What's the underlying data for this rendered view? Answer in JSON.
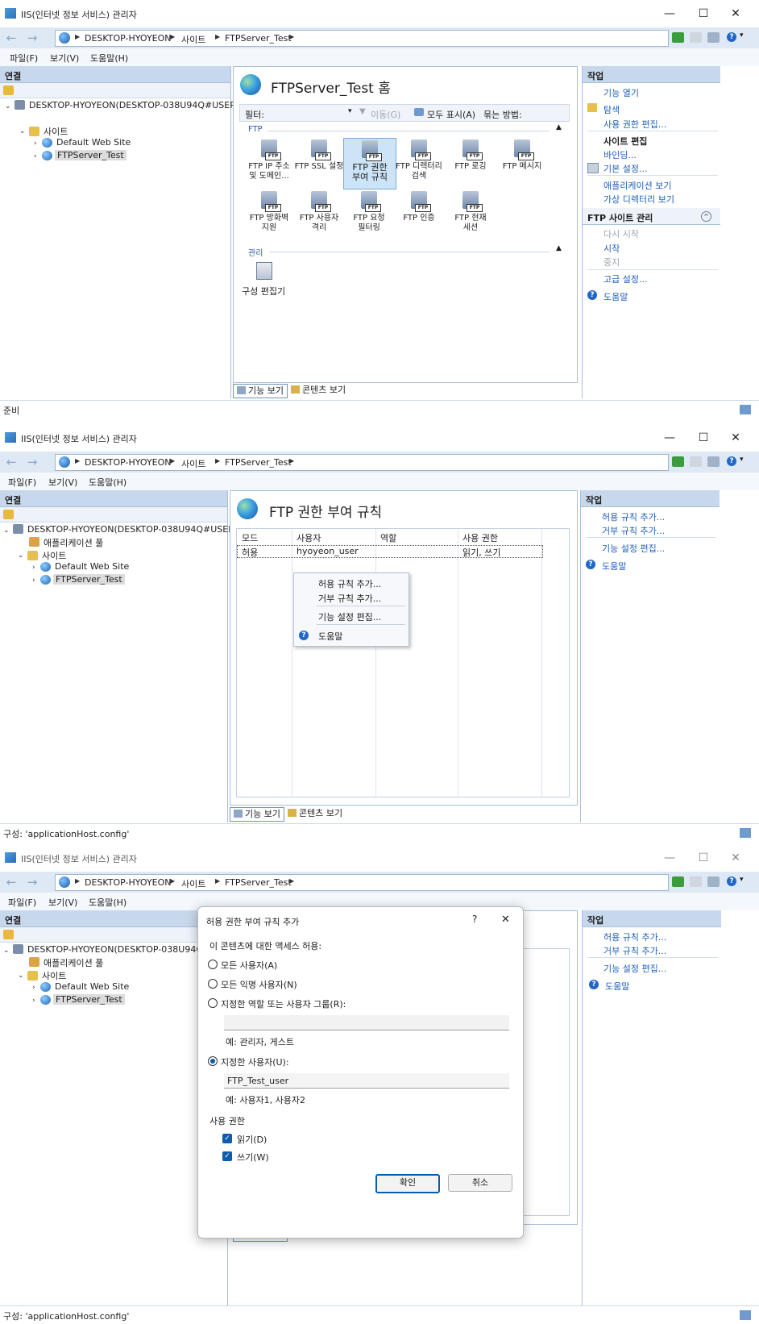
{
  "window": {
    "title": "IIS(인터넷 정보 서비스) 관리자",
    "controls": {
      "minimize": "—",
      "maximize": "☐",
      "close": "✕"
    }
  },
  "address": {
    "back": "←",
    "forward": "→",
    "crumbs": [
      "DESKTOP-HYOYEON",
      "사이트",
      "FTPServer_Test"
    ],
    "help_drop": "▾"
  },
  "menu": {
    "file": "파일(F)",
    "view": "보기(V)",
    "help": "도움말(H)"
  },
  "connections": {
    "title": "연결",
    "server": "DESKTOP-HYOYEON(DESKTOP-038U94Q#USER)",
    "server_short": "DESKTOP-HYOYEON(DESKTOP-038U94Q#U",
    "app_pools": "애플리케이션 풀",
    "sites": "사이트",
    "default_site": "Default Web Site",
    "ftp_site": "FTPServer_Test"
  },
  "panel1": {
    "title": "FTPServer_Test 홈",
    "filter_label": "필터:",
    "go": "이동(G)",
    "show_all": "모두 표시(A)",
    "group_by": "묶는 방법:",
    "group_ftp": "FTP",
    "group_mgmt": "관리",
    "tiles": [
      {
        "line1": "FTP IP 주소",
        "line2": "및 도메인..."
      },
      {
        "line1": "FTP SSL 설정",
        "line2": ""
      },
      {
        "line1": "FTP 권한",
        "line2": "부여 규칙"
      },
      {
        "line1": "FTP 디렉터리",
        "line2": "검색"
      },
      {
        "line1": "FTP 로깅",
        "line2": ""
      },
      {
        "line1": "FTP 메시지",
        "line2": ""
      },
      {
        "line1": "FTP 방화벽",
        "line2": "지원"
      },
      {
        "line1": "FTP 사용자",
        "line2": "격리"
      },
      {
        "line1": "FTP 요청",
        "line2": "필터링"
      },
      {
        "line1": "FTP 인증",
        "line2": ""
      },
      {
        "line1": "FTP 현재",
        "line2": "세션"
      }
    ],
    "config_editor": "구성 편집기"
  },
  "tabs": {
    "features": "기능 보기",
    "content": "콘텐츠 보기"
  },
  "actions1": {
    "title": "작업",
    "open_feature": "기능 열기",
    "explore": "탐색",
    "edit_perms": "사용 권한 편집...",
    "edit_site": "사이트 편집",
    "bindings": "바인딩...",
    "basic_settings": "기본 설정...",
    "view_apps": "애플리케이션 보기",
    "view_vdirs": "가상 디렉터리 보기",
    "manage_ftp": "FTP 사이트 관리",
    "restart": "다시 시작",
    "start": "시작",
    "stop": "중지",
    "advanced": "고급 설정...",
    "help": "도움말"
  },
  "status": {
    "ready": "준비",
    "config": "구성: 'applicationHost.config'"
  },
  "panel2": {
    "title": "FTP 권한 부여 규칙",
    "columns": [
      "모드",
      "사용자",
      "역할",
      "사용 권한"
    ],
    "row": [
      "허용",
      "hyoyeon_user",
      "",
      "읽기, 쓰기"
    ]
  },
  "context_menu": {
    "add_allow": "허용 규칙 추가...",
    "add_deny": "거부 규칙 추가...",
    "edit_settings": "기능 설정 편집...",
    "help": "도움말"
  },
  "actions2": {
    "title": "작업",
    "add_allow": "허용 규칙 추가...",
    "add_deny": "거부 규칙 추가...",
    "edit_settings": "기능 설정 편집...",
    "help": "도움말"
  },
  "dialog": {
    "title": "허용 권한 부여 규칙 추가",
    "question": "?",
    "close": "✕",
    "access_label": "이 콘텐츠에 대한 액세스 허용:",
    "all_users": "모든 사용자(A)",
    "all_anon": "모든 익명 사용자(N)",
    "roles_groups": "지정한 역할 또는 사용자 그룹(R):",
    "roles_value": "",
    "roles_example": "예: 관리자, 게스트",
    "specified_users": "지정한 사용자(U):",
    "users_value": "FTP_Test_user",
    "users_example": "예: 사용자1, 사용자2",
    "perms_label": "사용 권한",
    "read": "읽기(D)",
    "write": "쓰기(W)",
    "ok": "확인",
    "cancel": "취소"
  }
}
